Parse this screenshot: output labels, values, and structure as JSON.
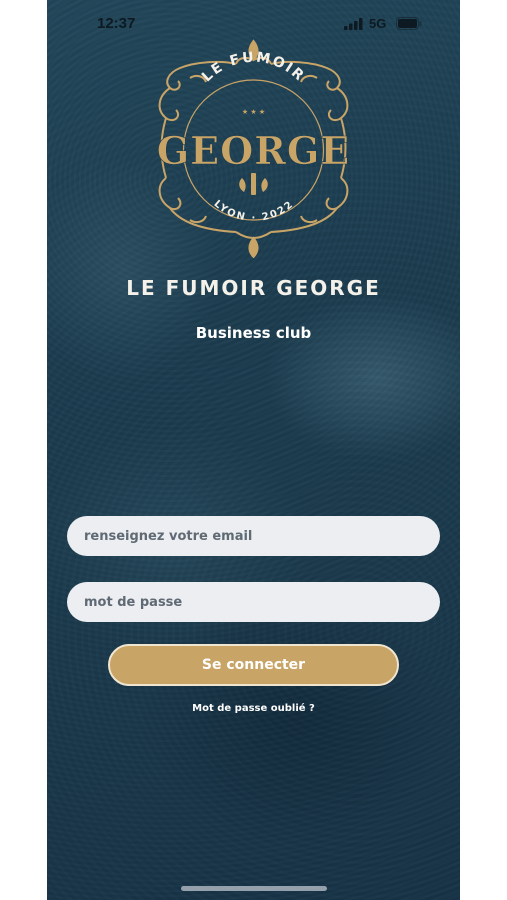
{
  "status_bar": {
    "time": "12:37",
    "network": "5G",
    "icons": [
      "signal-icon",
      "battery-icon"
    ]
  },
  "logo": {
    "top_text": "LE FUMOIR",
    "main_text": "GEORGE",
    "bottom_text": "LYON · 2022",
    "colors": {
      "gold": "#c9a467"
    }
  },
  "brand": {
    "title": "LE FUMOIR GEORGE",
    "subtitle": "Business club"
  },
  "login_form": {
    "email_placeholder": "renseignez votre email",
    "password_placeholder": "mot de passe",
    "submit_label": "Se connecter",
    "forgot_password_label": "Mot de passe oublié ?"
  },
  "colors": {
    "background": "#1c3d50",
    "accent": "#c9a467",
    "input_background": "#edeef1"
  }
}
